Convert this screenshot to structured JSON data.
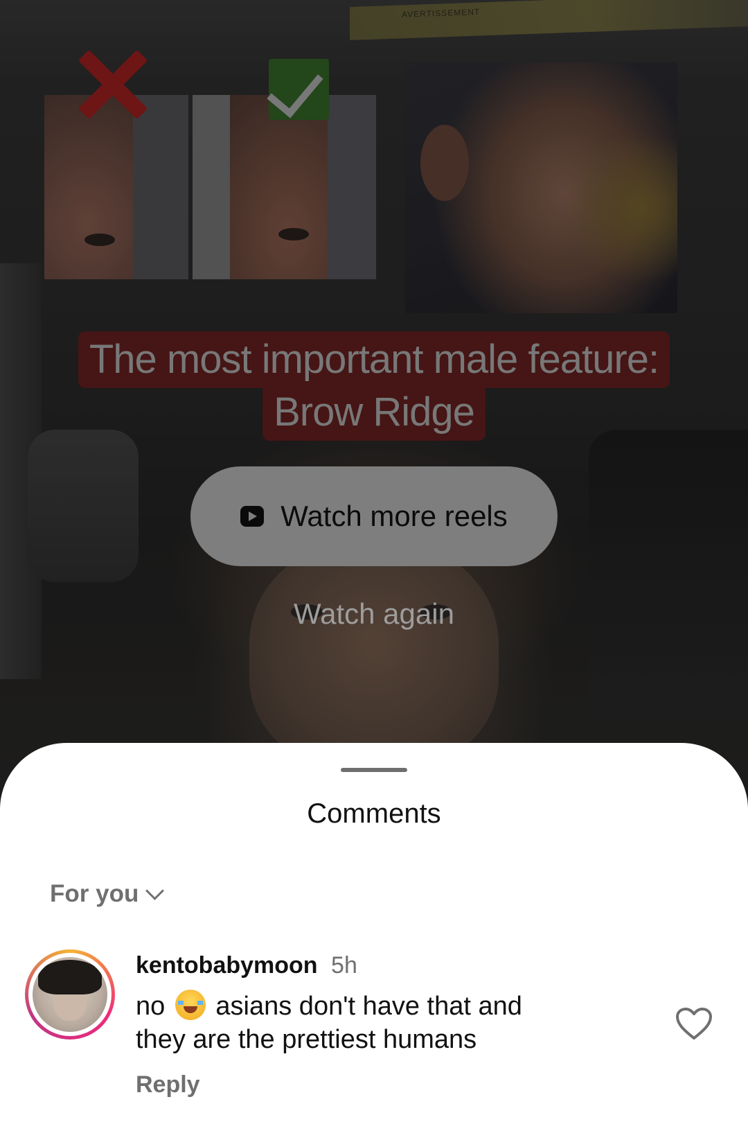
{
  "video": {
    "visor_text": "AVERTISSEMENT",
    "caption_line1": "The most important male feature:",
    "caption_line2": "Brow Ridge",
    "mark_bad_icon": "x-mark-icon",
    "mark_good_icon": "check-mark-icon"
  },
  "end_screen": {
    "watch_more_label": "Watch more reels",
    "watch_more_icon": "reel-play-icon",
    "watch_again_label": "Watch again"
  },
  "comments": {
    "title": "Comments",
    "filter_label": "For you",
    "items": [
      {
        "username": "kentobabymoon",
        "time": "5h",
        "text_before_emoji": "no",
        "emoji": "face-with-tears-of-joy",
        "text_after_emoji": "asians don't have that and they are the prettiest humans",
        "reply_label": "Reply",
        "like_icon": "heart-outline-icon"
      }
    ]
  },
  "colors": {
    "caption_bg": "#5a1c1c",
    "button_bg": "#7e7e7e",
    "sheet_bg": "#ffffff",
    "muted_text": "#6f6f6f"
  }
}
